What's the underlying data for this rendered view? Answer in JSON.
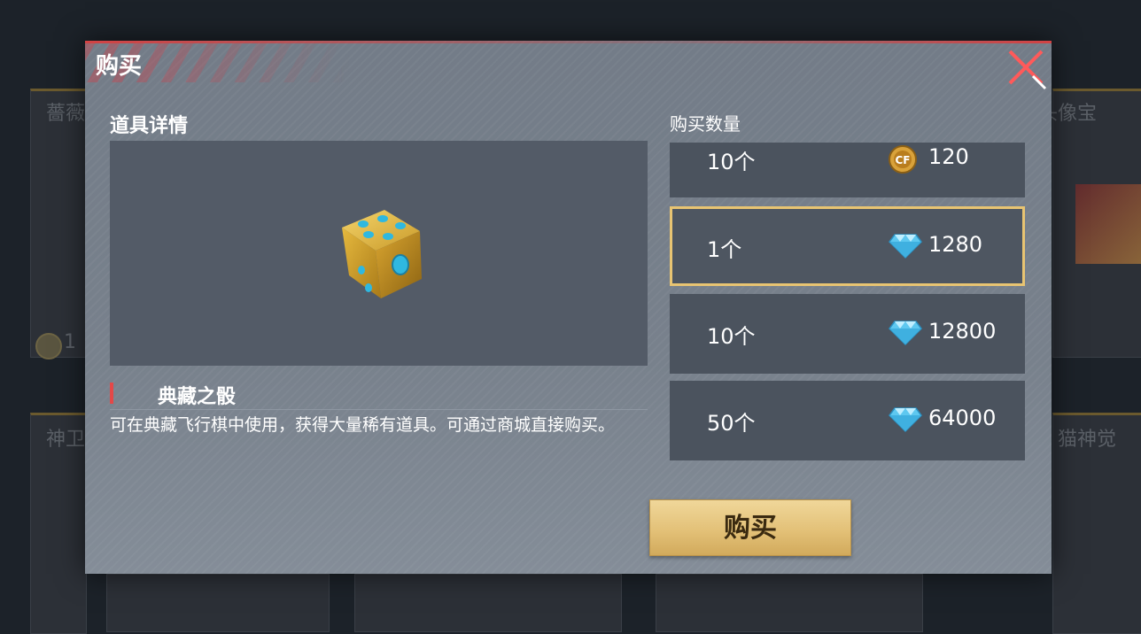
{
  "background": {
    "card_texts": [
      "薔薇",
      "机头像宝",
      "1",
      "神卫",
      "猫神觉"
    ]
  },
  "modal": {
    "title": "购买",
    "detail_section_title": "道具详情",
    "quantity_section_title": "购买数量",
    "item": {
      "name": "典藏之骰",
      "description": "可在典藏飞行棋中使用，获得大量稀有道具。可通过商城直接购买。"
    },
    "options": [
      {
        "qty": "10个",
        "price": "120",
        "currency_icon": "cf-coin-icon",
        "selected": false
      },
      {
        "qty": "1个",
        "price": "1280",
        "currency_icon": "diamond-icon",
        "selected": true
      },
      {
        "qty": "10个",
        "price": "12800",
        "currency_icon": "diamond-icon",
        "selected": false
      },
      {
        "qty": "50个",
        "price": "64000",
        "currency_icon": "diamond-icon",
        "selected": false
      }
    ],
    "buy_button_label": "购买"
  },
  "colors": {
    "accent_gold": "#e8c472",
    "accent_red": "#e44848"
  }
}
